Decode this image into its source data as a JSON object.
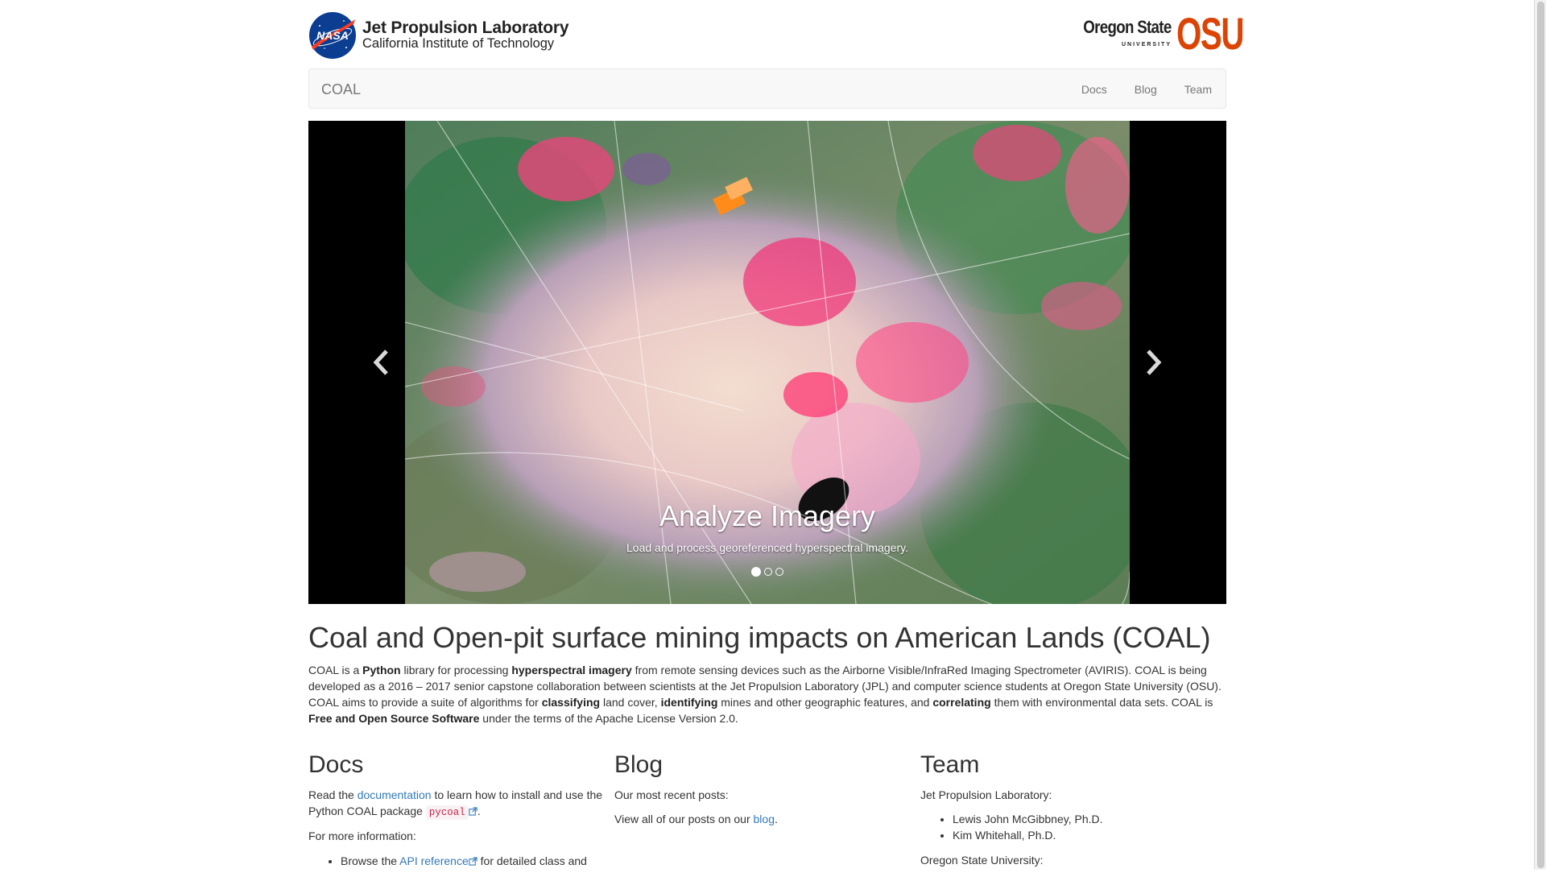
{
  "header": {
    "jpl_title": "Jet Propulsion Laboratory",
    "jpl_subtitle": "California Institute of Technology",
    "nasa_logo_text": "NASA",
    "osu_state": "Oregon State",
    "osu_university": "UNIVERSITY",
    "osu_mark": "OSU"
  },
  "navbar": {
    "brand": "COAL",
    "links": [
      "Docs",
      "Blog",
      "Team"
    ]
  },
  "carousel": {
    "caption_title": "Analyze Imagery",
    "caption_text": "Load and process georeferenced hyperspectral imagery.",
    "slide_count": 3,
    "active_slide": 1
  },
  "main": {
    "title": "Coal and Open-pit surface mining impacts on American Lands (COAL)",
    "intro": {
      "t1": "COAL is a ",
      "b1": "Python",
      "t2": " library for processing ",
      "b2": "hyperspectral imagery",
      "t3": " from remote sensing devices such as the Airborne Visible/InfraRed Imaging Spectrometer (AVIRIS). COAL is being developed as a 2016 – 2017 senior capstone collaboration between scientists at the Jet Propulsion Laboratory (JPL) and computer science students at Oregon State University (OSU). COAL aims to provide a suite of algorithms for ",
      "b3": "classifying",
      "t4": " land cover, ",
      "b4": "identifying",
      "t5": " mines and other geographic features, and ",
      "b5": "correlating",
      "t6": " them with environmental data sets. COAL is ",
      "b6": "Free and Open Source Software",
      "t7": " under the terms of the Apache License Version 2.0."
    }
  },
  "docs": {
    "heading": "Docs",
    "p1_a": "Read the ",
    "p1_link": "documentation",
    "p1_b": " to learn how to install and use the Python COAL package ",
    "p1_code": "pycoal",
    "p1_end": ".",
    "p2": "For more information:",
    "li1_a": "Browse the ",
    "li1_link": "API reference",
    "li1_b": " for detailed class and"
  },
  "blog": {
    "heading": "Blog",
    "p1": "Our most recent posts:",
    "p2_a": "View all of our posts on our ",
    "p2_link": "blog",
    "p2_end": "."
  },
  "team": {
    "heading": "Team",
    "jpl_label": "Jet Propulsion Laboratory:",
    "jpl_members": [
      "Lewis John McGibbney, Ph.D.",
      "Kim Whitehall, Ph.D."
    ],
    "osu_label": "Oregon State University:"
  },
  "colors": {
    "link": "#337ab7",
    "osu_orange": "#dc4405",
    "nasa_blue": "#0b3d91",
    "nasa_red": "#fc3d21"
  }
}
